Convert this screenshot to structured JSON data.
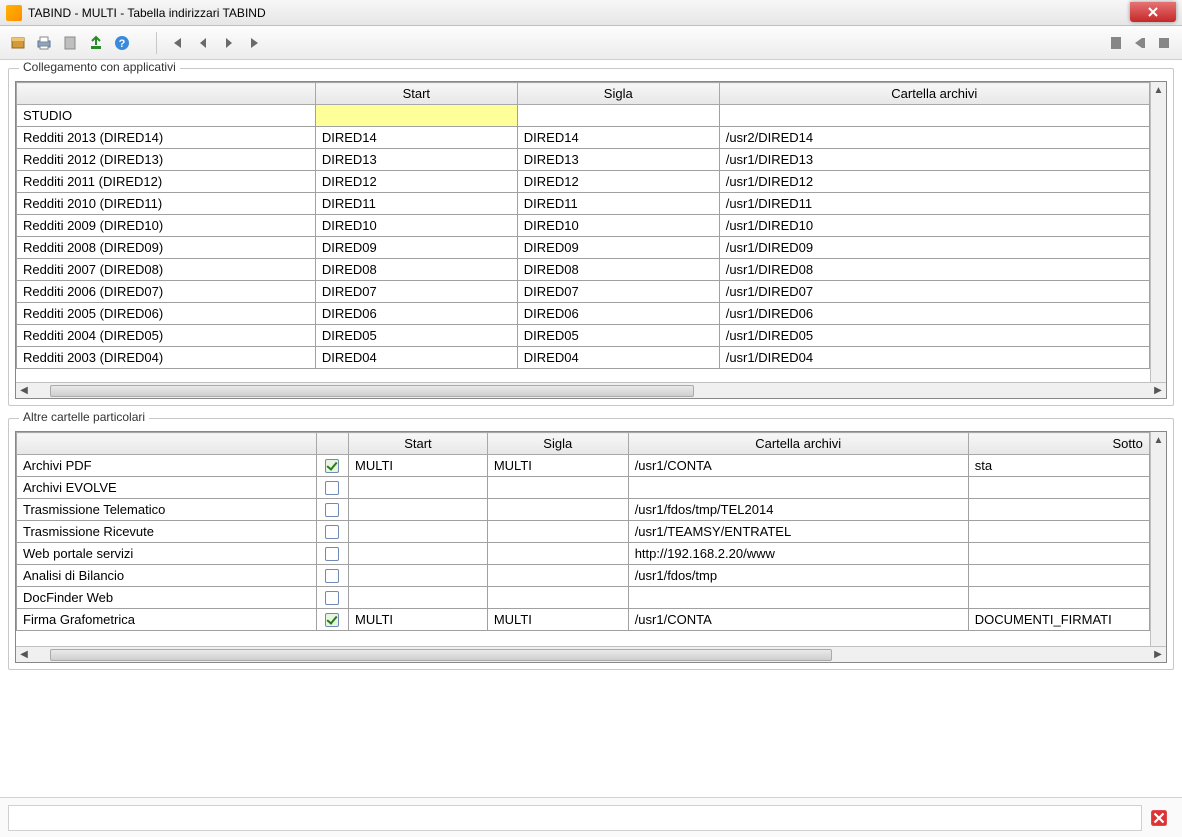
{
  "window": {
    "title": "TABIND  - MULTI -  Tabella indirizzari TABIND"
  },
  "fieldsets": {
    "top": "Collegamento con applicativi",
    "bottom": "Altre cartelle particolari"
  },
  "table1": {
    "headers": [
      "",
      "Start",
      "Sigla",
      "Cartella archivi"
    ],
    "rows": [
      {
        "name": "STUDIO",
        "start": "",
        "sigla": "",
        "path": "",
        "highlight": true
      },
      {
        "name": "Redditi 2013 (DIRED14)",
        "start": "DIRED14",
        "sigla": "DIRED14",
        "path": "/usr2/DIRED14"
      },
      {
        "name": "Redditi 2012 (DIRED13)",
        "start": "DIRED13",
        "sigla": "DIRED13",
        "path": "/usr1/DIRED13"
      },
      {
        "name": "Redditi 2011 (DIRED12)",
        "start": "DIRED12",
        "sigla": "DIRED12",
        "path": "/usr1/DIRED12"
      },
      {
        "name": "Redditi 2010 (DIRED11)",
        "start": "DIRED11",
        "sigla": "DIRED11",
        "path": "/usr1/DIRED11"
      },
      {
        "name": "Redditi 2009 (DIRED10)",
        "start": "DIRED10",
        "sigla": "DIRED10",
        "path": "/usr1/DIRED10"
      },
      {
        "name": "Redditi 2008 (DIRED09)",
        "start": "DIRED09",
        "sigla": "DIRED09",
        "path": "/usr1/DIRED09"
      },
      {
        "name": "Redditi 2007 (DIRED08)",
        "start": "DIRED08",
        "sigla": "DIRED08",
        "path": "/usr1/DIRED08"
      },
      {
        "name": "Redditi 2006 (DIRED07)",
        "start": "DIRED07",
        "sigla": "DIRED07",
        "path": "/usr1/DIRED07"
      },
      {
        "name": "Redditi 2005 (DIRED06)",
        "start": "DIRED06",
        "sigla": "DIRED06",
        "path": "/usr1/DIRED06"
      },
      {
        "name": "Redditi 2004 (DIRED05)",
        "start": "DIRED05",
        "sigla": "DIRED05",
        "path": "/usr1/DIRED05"
      },
      {
        "name": "Redditi 2003 (DIRED04)",
        "start": "DIRED04",
        "sigla": "DIRED04",
        "path": "/usr1/DIRED04"
      }
    ]
  },
  "table2": {
    "headers": [
      "",
      "",
      "Start",
      "Sigla",
      "Cartella archivi",
      "Sotto"
    ],
    "rows": [
      {
        "name": "Archivi PDF",
        "checked": true,
        "start": "MULTI",
        "sigla": "MULTI",
        "path": "/usr1/CONTA",
        "sub": "sta"
      },
      {
        "name": "Archivi EVOLVE",
        "checked": false,
        "start": "",
        "sigla": "",
        "path": "",
        "sub": ""
      },
      {
        "name": "Trasmissione Telematico",
        "checked": false,
        "start": "",
        "sigla": "",
        "path": "/usr1/fdos/tmp/TEL2014",
        "sub": ""
      },
      {
        "name": "Trasmissione Ricevute",
        "checked": false,
        "start": "",
        "sigla": "",
        "path": "/usr1/TEAMSY/ENTRATEL",
        "sub": ""
      },
      {
        "name": "Web portale servizi",
        "checked": false,
        "start": "",
        "sigla": "",
        "path": "http://192.168.2.20/www",
        "sub": ""
      },
      {
        "name": "Analisi di Bilancio",
        "checked": false,
        "start": "",
        "sigla": "",
        "path": "/usr1/fdos/tmp",
        "sub": ""
      },
      {
        "name": "DocFinder Web",
        "checked": false,
        "start": "",
        "sigla": "",
        "path": "",
        "sub": ""
      },
      {
        "name": "Firma Grafometrica",
        "checked": true,
        "start": "MULTI",
        "sigla": "MULTI",
        "path": "/usr1/CONTA",
        "sub": "DOCUMENTI_FIRMATI"
      }
    ]
  }
}
